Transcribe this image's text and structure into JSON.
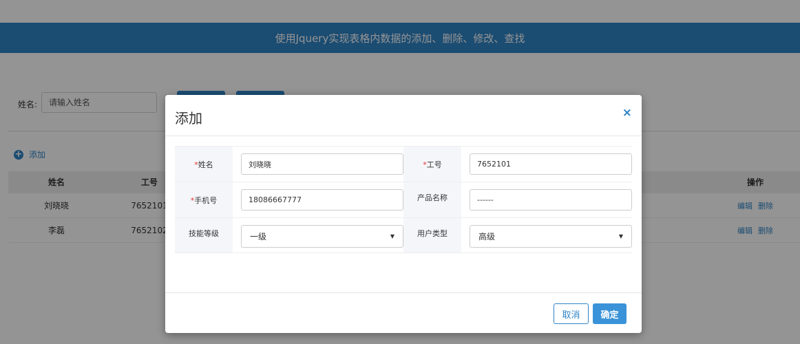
{
  "header": {
    "title": "使用Jquery实现表格内数据的添加、删除、修改、查找"
  },
  "search": {
    "label": "姓名:",
    "placeholder": "请输入姓名"
  },
  "add_link": {
    "label": "添加"
  },
  "table": {
    "columns": [
      "姓名",
      "工号",
      "操作"
    ],
    "rows": [
      {
        "name": "刘晓晓",
        "id": "7652101",
        "edit": "编辑",
        "delete": "删除"
      },
      {
        "name": "李磊",
        "id": "7652102",
        "edit": "编辑",
        "delete": "删除"
      }
    ]
  },
  "modal": {
    "title": "添加",
    "close": "×",
    "fields": {
      "name": {
        "label": "姓名",
        "required_mark": "*",
        "value": "刘晓晓"
      },
      "job_no": {
        "label": "工号",
        "required_mark": "*",
        "value": "7652101"
      },
      "phone": {
        "label": "手机号",
        "required_mark": "*",
        "value": "18086667777"
      },
      "product": {
        "label": "产品名称",
        "value": "------"
      },
      "skill": {
        "label": "技能等级",
        "value": "一级"
      },
      "user_type": {
        "label": "用户类型",
        "value": "高级"
      }
    },
    "cancel_label": "取消",
    "ok_label": "确定"
  },
  "colors": {
    "primary": "#2f83c5",
    "required": "#e03030"
  },
  "icons": {
    "close": "close-icon",
    "add": "plus-circle-icon",
    "dropdown": "chevron-down-icon"
  }
}
